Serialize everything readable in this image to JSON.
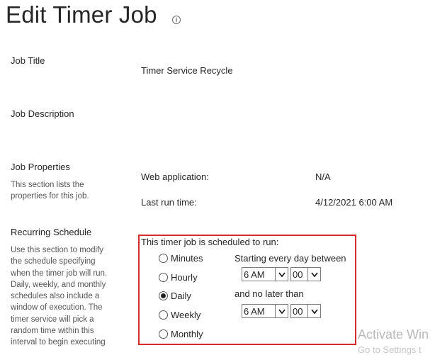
{
  "page": {
    "title": "Edit Timer Job",
    "info_icon": "info-circle-icon"
  },
  "job_title": {
    "label": "Job Title",
    "value": "Timer Service Recycle"
  },
  "job_description": {
    "label": "Job Description"
  },
  "job_properties": {
    "label": "Job Properties",
    "description": "This section lists the properties for this job.",
    "web_application_label": "Web application:",
    "web_application_value": "N/A",
    "last_run_label": "Last run time:",
    "last_run_value": "4/12/2021 6:00 AM"
  },
  "recurring_schedule": {
    "label": "Recurring Schedule",
    "description": "Use this section to modify the schedule specifying when the timer job will run. Daily, weekly, and monthly schedules also include a window of execution. The timer service will pick a random time within this interval to begin executing",
    "heading": "This timer job is scheduled to run:",
    "options": [
      "Minutes",
      "Hourly",
      "Daily",
      "Weekly",
      "Monthly"
    ],
    "selected": "Daily",
    "starting_label": "Starting every day between",
    "start_hour": "6 AM",
    "start_minute": "00",
    "no_later_label": "and no later than",
    "end_hour": "6 AM",
    "end_minute": "00"
  },
  "watermark": {
    "line1": "Activate Win",
    "line2": "Go to Settings t"
  },
  "colors": {
    "highlight_border": "#d62a2f",
    "text": "#262626"
  }
}
